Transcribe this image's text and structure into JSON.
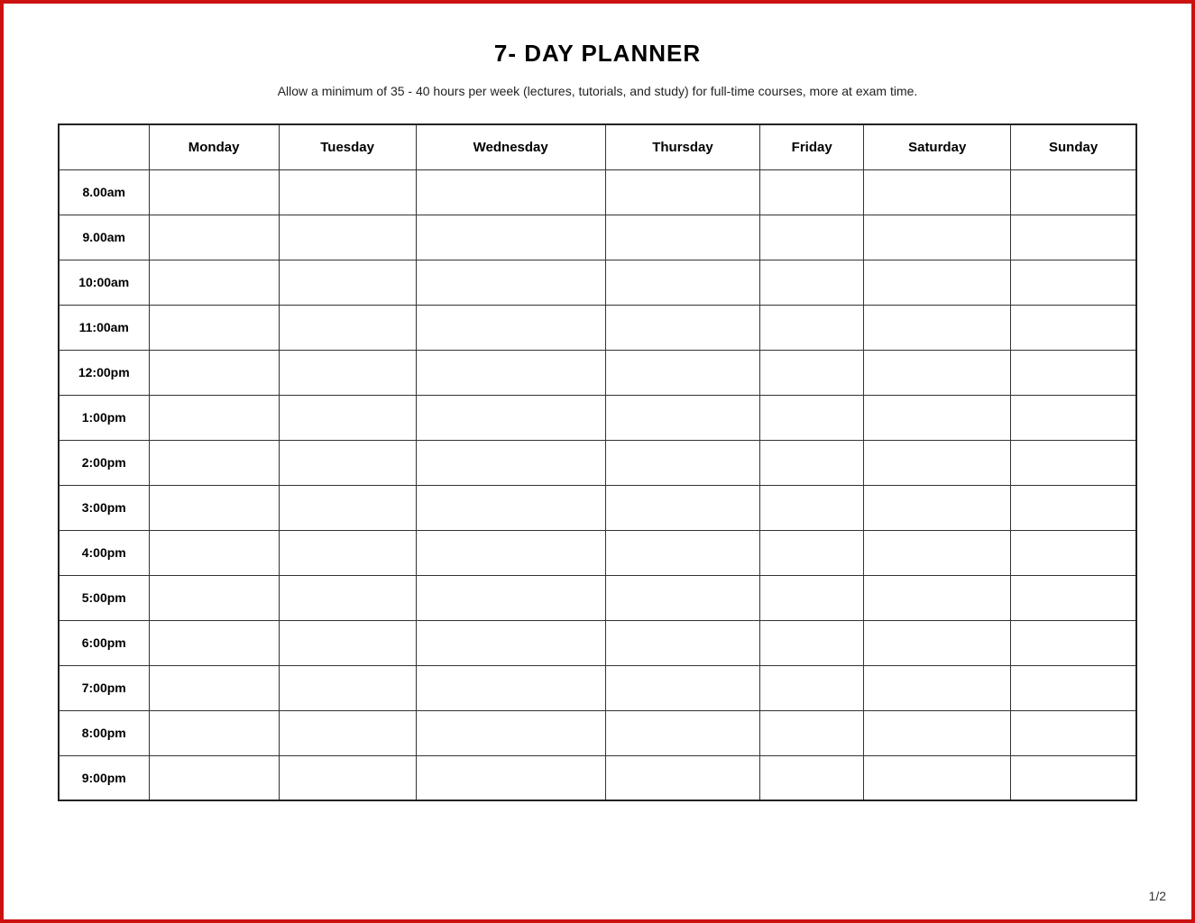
{
  "title": "7- DAY PLANNER",
  "subtitle": "Allow a minimum of 35 - 40 hours per week (lectures, tutorials, and study) for full-time courses, more at exam time.",
  "columns": [
    "",
    "Monday",
    "Tuesday",
    "Wednesday",
    "Thursday",
    "Friday",
    "Saturday",
    "Sunday"
  ],
  "time_slots": [
    "8.00am",
    "9.00am",
    "10:00am",
    "11:00am",
    "12:00pm",
    "1:00pm",
    "2:00pm",
    "3:00pm",
    "4:00pm",
    "5:00pm",
    "6:00pm",
    "7:00pm",
    "8:00pm",
    "9:00pm"
  ],
  "page_number": "1/2"
}
